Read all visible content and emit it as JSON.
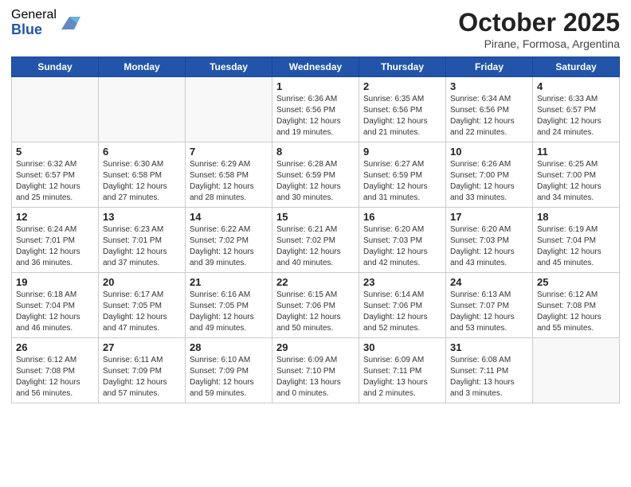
{
  "logo": {
    "general": "General",
    "blue": "Blue"
  },
  "title": "October 2025",
  "subtitle": "Pirane, Formosa, Argentina",
  "days_of_week": [
    "Sunday",
    "Monday",
    "Tuesday",
    "Wednesday",
    "Thursday",
    "Friday",
    "Saturday"
  ],
  "weeks": [
    [
      {
        "day": "",
        "info": ""
      },
      {
        "day": "",
        "info": ""
      },
      {
        "day": "",
        "info": ""
      },
      {
        "day": "1",
        "info": "Sunrise: 6:36 AM\nSunset: 6:56 PM\nDaylight: 12 hours\nand 19 minutes."
      },
      {
        "day": "2",
        "info": "Sunrise: 6:35 AM\nSunset: 6:56 PM\nDaylight: 12 hours\nand 21 minutes."
      },
      {
        "day": "3",
        "info": "Sunrise: 6:34 AM\nSunset: 6:56 PM\nDaylight: 12 hours\nand 22 minutes."
      },
      {
        "day": "4",
        "info": "Sunrise: 6:33 AM\nSunset: 6:57 PM\nDaylight: 12 hours\nand 24 minutes."
      }
    ],
    [
      {
        "day": "5",
        "info": "Sunrise: 6:32 AM\nSunset: 6:57 PM\nDaylight: 12 hours\nand 25 minutes."
      },
      {
        "day": "6",
        "info": "Sunrise: 6:30 AM\nSunset: 6:58 PM\nDaylight: 12 hours\nand 27 minutes."
      },
      {
        "day": "7",
        "info": "Sunrise: 6:29 AM\nSunset: 6:58 PM\nDaylight: 12 hours\nand 28 minutes."
      },
      {
        "day": "8",
        "info": "Sunrise: 6:28 AM\nSunset: 6:59 PM\nDaylight: 12 hours\nand 30 minutes."
      },
      {
        "day": "9",
        "info": "Sunrise: 6:27 AM\nSunset: 6:59 PM\nDaylight: 12 hours\nand 31 minutes."
      },
      {
        "day": "10",
        "info": "Sunrise: 6:26 AM\nSunset: 7:00 PM\nDaylight: 12 hours\nand 33 minutes."
      },
      {
        "day": "11",
        "info": "Sunrise: 6:25 AM\nSunset: 7:00 PM\nDaylight: 12 hours\nand 34 minutes."
      }
    ],
    [
      {
        "day": "12",
        "info": "Sunrise: 6:24 AM\nSunset: 7:01 PM\nDaylight: 12 hours\nand 36 minutes."
      },
      {
        "day": "13",
        "info": "Sunrise: 6:23 AM\nSunset: 7:01 PM\nDaylight: 12 hours\nand 37 minutes."
      },
      {
        "day": "14",
        "info": "Sunrise: 6:22 AM\nSunset: 7:02 PM\nDaylight: 12 hours\nand 39 minutes."
      },
      {
        "day": "15",
        "info": "Sunrise: 6:21 AM\nSunset: 7:02 PM\nDaylight: 12 hours\nand 40 minutes."
      },
      {
        "day": "16",
        "info": "Sunrise: 6:20 AM\nSunset: 7:03 PM\nDaylight: 12 hours\nand 42 minutes."
      },
      {
        "day": "17",
        "info": "Sunrise: 6:20 AM\nSunset: 7:03 PM\nDaylight: 12 hours\nand 43 minutes."
      },
      {
        "day": "18",
        "info": "Sunrise: 6:19 AM\nSunset: 7:04 PM\nDaylight: 12 hours\nand 45 minutes."
      }
    ],
    [
      {
        "day": "19",
        "info": "Sunrise: 6:18 AM\nSunset: 7:04 PM\nDaylight: 12 hours\nand 46 minutes."
      },
      {
        "day": "20",
        "info": "Sunrise: 6:17 AM\nSunset: 7:05 PM\nDaylight: 12 hours\nand 47 minutes."
      },
      {
        "day": "21",
        "info": "Sunrise: 6:16 AM\nSunset: 7:05 PM\nDaylight: 12 hours\nand 49 minutes."
      },
      {
        "day": "22",
        "info": "Sunrise: 6:15 AM\nSunset: 7:06 PM\nDaylight: 12 hours\nand 50 minutes."
      },
      {
        "day": "23",
        "info": "Sunrise: 6:14 AM\nSunset: 7:06 PM\nDaylight: 12 hours\nand 52 minutes."
      },
      {
        "day": "24",
        "info": "Sunrise: 6:13 AM\nSunset: 7:07 PM\nDaylight: 12 hours\nand 53 minutes."
      },
      {
        "day": "25",
        "info": "Sunrise: 6:12 AM\nSunset: 7:08 PM\nDaylight: 12 hours\nand 55 minutes."
      }
    ],
    [
      {
        "day": "26",
        "info": "Sunrise: 6:12 AM\nSunset: 7:08 PM\nDaylight: 12 hours\nand 56 minutes."
      },
      {
        "day": "27",
        "info": "Sunrise: 6:11 AM\nSunset: 7:09 PM\nDaylight: 12 hours\nand 57 minutes."
      },
      {
        "day": "28",
        "info": "Sunrise: 6:10 AM\nSunset: 7:09 PM\nDaylight: 12 hours\nand 59 minutes."
      },
      {
        "day": "29",
        "info": "Sunrise: 6:09 AM\nSunset: 7:10 PM\nDaylight: 13 hours\nand 0 minutes."
      },
      {
        "day": "30",
        "info": "Sunrise: 6:09 AM\nSunset: 7:11 PM\nDaylight: 13 hours\nand 2 minutes."
      },
      {
        "day": "31",
        "info": "Sunrise: 6:08 AM\nSunset: 7:11 PM\nDaylight: 13 hours\nand 3 minutes."
      },
      {
        "day": "",
        "info": ""
      }
    ]
  ]
}
